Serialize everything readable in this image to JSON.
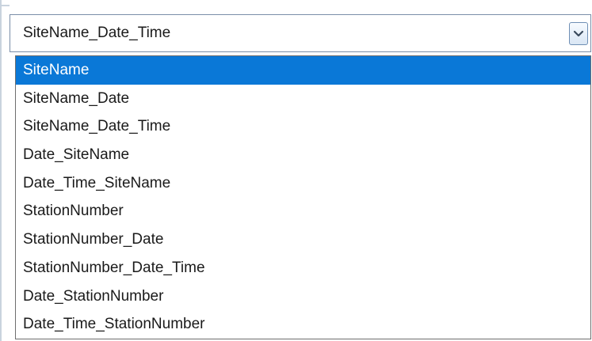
{
  "combo": {
    "value": "SiteName_Date_Time",
    "button_icon": "chevron-down-icon"
  },
  "dropdown": {
    "selected_index": 0,
    "items": [
      "SiteName",
      "SiteName_Date",
      "SiteName_Date_Time",
      "Date_SiteName",
      "Date_Time_SiteName",
      "StationNumber",
      "StationNumber_Date",
      "StationNumber_Date_Time",
      "Date_StationNumber",
      "Date_Time_StationNumber"
    ]
  },
  "colors": {
    "selection": "#0a78d7",
    "border": "#7a8ea8"
  }
}
